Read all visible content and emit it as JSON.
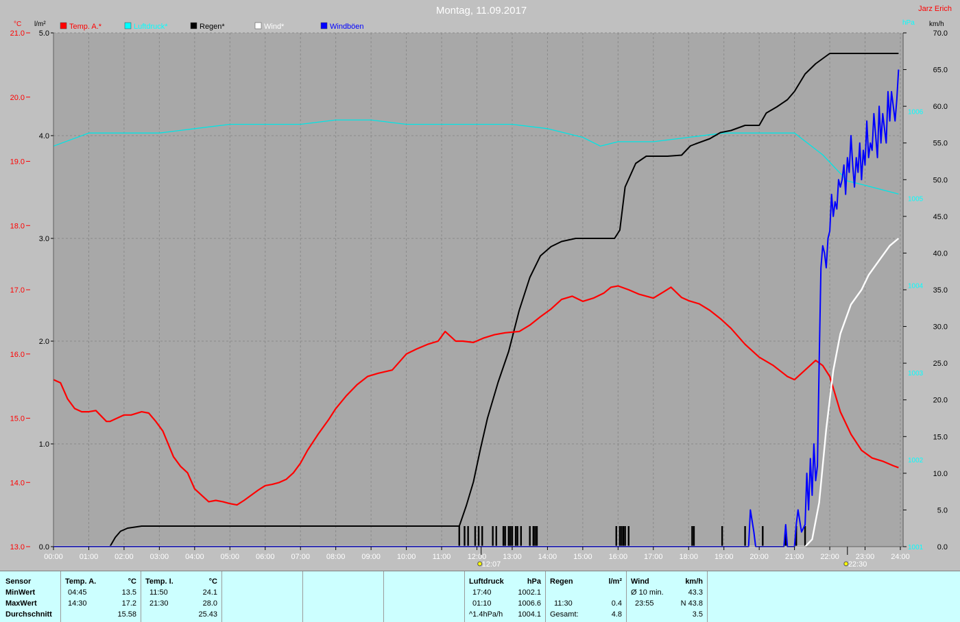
{
  "title": "Montag, 11.09.2017",
  "station": "Jarz Erich",
  "colors": {
    "temp": "#ff0000",
    "pressure": "#00ffff",
    "rain": "#000000",
    "wind": "#ffffff",
    "gust": "#0000ff",
    "bg": "#c0c0c0",
    "plot": "#a8a8a8",
    "table": "#ccffff"
  },
  "legend": [
    {
      "label": "Temp. A.*",
      "color": "#ff0000"
    },
    {
      "label": "Luftdruck*",
      "color": "#00ffff"
    },
    {
      "label": "Regen*",
      "color": "#000000"
    },
    {
      "label": "Wind*",
      "color": "#ffffff"
    },
    {
      "label": "Windböen",
      "color": "#0000ff"
    }
  ],
  "axes": {
    "temp_unit": "°C",
    "rain_unit": "l/m²",
    "pressure_unit": "hPa",
    "wind_unit": "km/h",
    "temp_ticks": [
      "21.0",
      "20.0",
      "19.0",
      "18.0",
      "17.0",
      "16.0",
      "15.0",
      "14.0",
      "13.0"
    ],
    "rain_ticks": [
      "5.0",
      "4.0",
      "3.0",
      "2.0",
      "1.0",
      "0.0"
    ],
    "wind_ticks": [
      "70.0",
      "65.0",
      "60.0",
      "55.0",
      "50.0",
      "45.0",
      "40.0",
      "35.0",
      "30.0",
      "25.0",
      "20.0",
      "15.0",
      "10.0",
      "5.0",
      "0.0"
    ],
    "pressure_ticks": [
      "1006",
      "1005",
      "1004",
      "1003",
      "1002",
      "1001"
    ],
    "time_ticks": [
      "00:00",
      "01:00",
      "02:00",
      "03:00",
      "04:00",
      "05:00",
      "06:00",
      "07:00",
      "08:00",
      "09:00",
      "10:00",
      "11:00",
      "12:00",
      "13:00",
      "14:00",
      "15:00",
      "16:00",
      "17:00",
      "18:00",
      "19:00",
      "20:00",
      "21:00",
      "22:00",
      "23:00",
      "24:00"
    ],
    "markers": [
      {
        "time": "12:07",
        "h": 12.12
      },
      {
        "time": "22:30",
        "h": 22.5
      }
    ]
  },
  "chart_data": {
    "type": "line",
    "title": "Montag, 11.09.2017",
    "x_unit": "hours",
    "xlim": [
      0,
      24
    ],
    "series": [
      {
        "name": "Temp. A.*",
        "axis": "°C",
        "ylim": [
          13,
          21
        ],
        "x": [
          0,
          0.2,
          0.4,
          0.6,
          0.8,
          1.0,
          1.2,
          1.5,
          1.6,
          1.8,
          2.0,
          2.2,
          2.5,
          2.7,
          2.9,
          3.1,
          3.4,
          3.6,
          3.8,
          4.0,
          4.2,
          4.4,
          4.6,
          4.8,
          5.0,
          5.2,
          5.4,
          5.6,
          5.8,
          6.0,
          6.2,
          6.4,
          6.6,
          6.8,
          7.0,
          7.2,
          7.5,
          7.8,
          8.0,
          8.3,
          8.6,
          8.9,
          9.2,
          9.6,
          10.0,
          10.3,
          10.6,
          10.9,
          11.1,
          11.4,
          11.6,
          11.9,
          12.2,
          12.5,
          12.8,
          13.2,
          13.5,
          13.8,
          14.1,
          14.4,
          14.7,
          15.0,
          15.3,
          15.6,
          15.8,
          16.0,
          16.3,
          16.6,
          17.0,
          17.3,
          17.5,
          17.8,
          18.0,
          18.3,
          18.6,
          18.9,
          19.2,
          19.6,
          20.0,
          20.4,
          20.8,
          21.0,
          21.3,
          21.6,
          21.8,
          22.0,
          22.3,
          22.6,
          22.9,
          23.2,
          23.5,
          23.8,
          23.95
        ],
        "values": [
          15.6,
          15.55,
          15.3,
          15.15,
          15.1,
          15.1,
          15.12,
          14.95,
          14.95,
          15.0,
          15.05,
          15.05,
          15.1,
          15.08,
          14.95,
          14.8,
          14.4,
          14.25,
          14.15,
          13.9,
          13.8,
          13.7,
          13.72,
          13.7,
          13.67,
          13.65,
          13.72,
          13.8,
          13.88,
          13.95,
          13.97,
          14.0,
          14.05,
          14.15,
          14.3,
          14.5,
          14.75,
          14.98,
          15.15,
          15.35,
          15.52,
          15.65,
          15.7,
          15.75,
          16.0,
          16.08,
          16.15,
          16.2,
          16.35,
          16.2,
          16.2,
          16.18,
          16.25,
          16.3,
          16.33,
          16.35,
          16.45,
          16.58,
          16.7,
          16.85,
          16.9,
          16.82,
          16.87,
          16.95,
          17.04,
          17.06,
          17.0,
          16.93,
          16.87,
          16.97,
          17.04,
          16.88,
          16.83,
          16.78,
          16.68,
          16.55,
          16.4,
          16.15,
          15.95,
          15.82,
          15.65,
          15.6,
          15.75,
          15.9,
          15.82,
          15.65,
          15.1,
          14.75,
          14.5,
          14.38,
          14.33,
          14.26,
          14.23
        ]
      },
      {
        "name": "Luftdruck*",
        "axis": "hPa",
        "ylim": [
          1001,
          1006.9
        ],
        "x": [
          0,
          1,
          2,
          3,
          4,
          5,
          6,
          7,
          8,
          9,
          10,
          11,
          12,
          13,
          14,
          15,
          15.5,
          16,
          17,
          18,
          19,
          20,
          21,
          21.8,
          22.5,
          23,
          23.95
        ],
        "values": [
          1005.6,
          1005.75,
          1005.75,
          1005.75,
          1005.8,
          1005.85,
          1005.85,
          1005.85,
          1005.9,
          1005.9,
          1005.85,
          1005.85,
          1005.85,
          1005.85,
          1005.8,
          1005.7,
          1005.6,
          1005.65,
          1005.65,
          1005.7,
          1005.75,
          1005.75,
          1005.75,
          1005.5,
          1005.2,
          1005.15,
          1005.05
        ]
      },
      {
        "name": "Regen*",
        "axis": "l/m²",
        "ylim": [
          0,
          5
        ],
        "x": [
          0,
          1.6,
          1.75,
          1.9,
          2.1,
          2.5,
          3,
          4,
          5,
          6,
          7,
          8,
          9,
          10,
          11,
          11.5,
          11.7,
          11.9,
          12.1,
          12.3,
          12.6,
          12.9,
          13.2,
          13.5,
          13.8,
          14.1,
          14.4,
          14.8,
          15.2,
          15.6,
          15.9,
          16.05,
          16.2,
          16.5,
          16.8,
          17.1,
          17.4,
          17.8,
          18.05,
          18.2,
          18.6,
          18.9,
          19.2,
          19.6,
          20.0,
          20.2,
          20.5,
          20.8,
          21.0,
          21.3,
          21.6,
          22.0,
          22.5,
          23.0,
          23.95
        ],
        "values": [
          0,
          0,
          0.09,
          0.15,
          0.18,
          0.2,
          0.2,
          0.2,
          0.2,
          0.2,
          0.2,
          0.2,
          0.2,
          0.2,
          0.2,
          0.2,
          0.4,
          0.63,
          0.95,
          1.25,
          1.6,
          1.9,
          2.3,
          2.62,
          2.83,
          2.92,
          2.97,
          3.0,
          3.0,
          3.0,
          3.0,
          3.08,
          3.5,
          3.73,
          3.8,
          3.8,
          3.8,
          3.81,
          3.9,
          3.92,
          3.97,
          4.03,
          4.05,
          4.1,
          4.1,
          4.22,
          4.28,
          4.35,
          4.43,
          4.6,
          4.7,
          4.8,
          4.8,
          4.8,
          4.8
        ]
      },
      {
        "name": "Wind*",
        "axis": "km/h",
        "ylim": [
          0,
          70
        ],
        "x": [
          0,
          21.3,
          21.5,
          21.7,
          21.9,
          22.1,
          22.3,
          22.6,
          22.9,
          23.1,
          23.4,
          23.7,
          23.95
        ],
        "values": [
          0,
          0,
          1,
          6,
          16,
          24,
          29,
          33,
          35,
          37,
          39,
          41,
          42
        ]
      },
      {
        "name": "Windböen",
        "axis": "km/h",
        "ylim": [
          0,
          70
        ],
        "x": [
          0,
          19.7,
          19.75,
          19.85,
          19.9,
          20.0,
          20.1,
          20.2,
          20.5,
          20.7,
          20.75,
          20.8,
          21.0,
          21.05,
          21.1,
          21.2,
          21.3,
          21.35,
          21.4,
          21.45,
          21.5,
          21.55,
          21.6,
          21.65,
          21.7,
          21.75,
          21.8,
          21.85,
          21.9,
          21.95,
          22.0,
          22.05,
          22.1,
          22.15,
          22.2,
          22.25,
          22.3,
          22.35,
          22.4,
          22.45,
          22.5,
          22.55,
          22.6,
          22.65,
          22.7,
          22.75,
          22.8,
          22.85,
          22.9,
          22.95,
          23.0,
          23.05,
          23.1,
          23.15,
          23.2,
          23.25,
          23.3,
          23.35,
          23.4,
          23.45,
          23.5,
          23.55,
          23.6,
          23.65,
          23.7,
          23.75,
          23.8,
          23.85,
          23.9,
          23.95
        ],
        "values": [
          0,
          0,
          5,
          2,
          0,
          0,
          0,
          0,
          0,
          0,
          3,
          0,
          0,
          3,
          5,
          2,
          3,
          10,
          5,
          12,
          7,
          14,
          9,
          11,
          25,
          38,
          41,
          40,
          38,
          42,
          43,
          48,
          45,
          47,
          46,
          50,
          49,
          50,
          52,
          48,
          53,
          51,
          56,
          52,
          49,
          53,
          51,
          55,
          50,
          54,
          52,
          58,
          53,
          55,
          54,
          59,
          56,
          53,
          60,
          55,
          59,
          57,
          55,
          62,
          58,
          62,
          60,
          58,
          61,
          65
        ]
      }
    ],
    "rain_events_x": [
      11.5,
      11.65,
      11.75,
      11.95,
      12.05,
      12.15,
      12.45,
      12.55,
      12.75,
      12.8,
      12.9,
      12.95,
      13.0,
      13.1,
      13.15,
      13.25,
      13.5,
      13.6,
      13.65,
      13.7,
      15.95,
      16.05,
      16.1,
      16.15,
      16.2,
      16.3,
      18.1,
      18.15,
      18.95,
      19.6,
      20.1,
      20.75,
      21.05,
      21.3
    ]
  },
  "summary": {
    "headers": {
      "sensor": "Sensor",
      "temp_a": "Temp. A.",
      "temp_a_unit": "°C",
      "temp_i": "Temp. I.",
      "temp_i_unit": "°C",
      "press": "Luftdruck",
      "press_unit": "hPa",
      "rain": "Regen",
      "rain_unit": "l/m²",
      "wind": "Wind",
      "wind_unit": "km/h"
    },
    "rows": [
      {
        "label": "MinWert",
        "ta_t": "04:45",
        "ta_v": "13.5",
        "ti_t": "11:50",
        "ti_v": "24.1",
        "p_t": "17:40",
        "p_v": "1002.1",
        "r_t": "",
        "r_v": "",
        "w_t": "Ø 10 min.",
        "w_v": "43.3"
      },
      {
        "label": "MaxWert",
        "ta_t": "14:30",
        "ta_v": "17.2",
        "ti_t": "21:30",
        "ti_v": "28.0",
        "p_t": "01:10",
        "p_v": "1006.6",
        "r_t": "11:30",
        "r_v": "0.4",
        "w_t": "23:55",
        "w_v": "N 43.8"
      },
      {
        "label": "Durchschnitt",
        "ta_t": "",
        "ta_v": "15.58",
        "ti_t": "",
        "ti_v": "25.43",
        "p_t": "^1.4hPa/h",
        "p_v": "1004.1",
        "r_t": "Gesamt:",
        "r_v": "4.8",
        "w_t": "",
        "w_v": "3.5"
      }
    ]
  }
}
